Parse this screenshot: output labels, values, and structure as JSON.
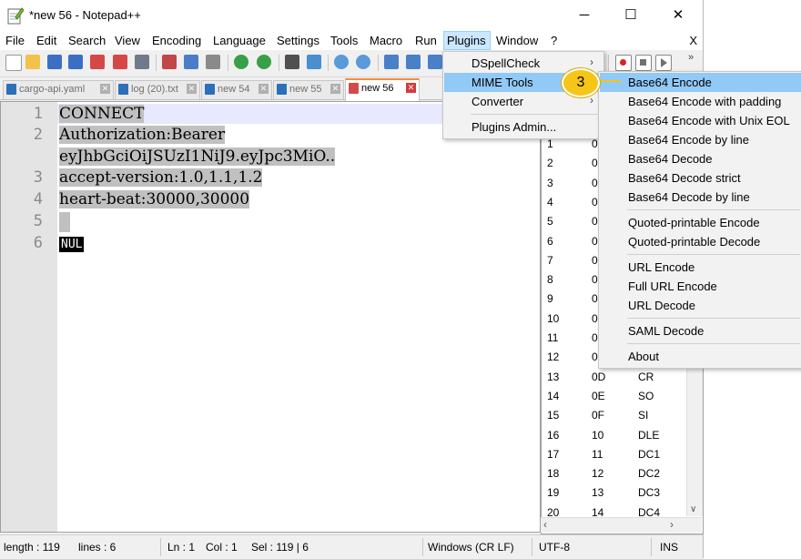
{
  "window": {
    "title": "*new 56 - Notepad++",
    "minimize": "─",
    "maximize": "☐",
    "close": "✕"
  },
  "menu": {
    "items": [
      "File",
      "Edit",
      "Search",
      "View",
      "Encoding",
      "Language",
      "Settings",
      "Tools",
      "Macro",
      "Run",
      "Plugins",
      "Window",
      "?"
    ],
    "close": "X"
  },
  "tabs": [
    "cargo-api.yaml",
    "log (20).txt",
    "new 54",
    "new 55",
    "new 56"
  ],
  "editor": {
    "line_numbers": [
      "1",
      "2",
      "3",
      "4",
      "5",
      "6"
    ],
    "lines": [
      "CONNECT",
      "Authorization:Bearer",
      "eyJhbGciOiJSUzI1NiJ9.eyJpc3MiO..",
      "accept-version:1.0,1.1,1.2",
      "heart-beat:30000,30000",
      "",
      "NUL"
    ]
  },
  "ascii_panel": {
    "rows": [
      {
        "dec": "1",
        "hex": "0",
        "name": ""
      },
      {
        "dec": "2",
        "hex": "0",
        "name": ""
      },
      {
        "dec": "3",
        "hex": "0",
        "name": ""
      },
      {
        "dec": "4",
        "hex": "0",
        "name": ""
      },
      {
        "dec": "5",
        "hex": "0",
        "name": ""
      },
      {
        "dec": "6",
        "hex": "0",
        "name": ""
      },
      {
        "dec": "7",
        "hex": "0",
        "name": ""
      },
      {
        "dec": "8",
        "hex": "0",
        "name": ""
      },
      {
        "dec": "9",
        "hex": "0",
        "name": ""
      },
      {
        "dec": "10",
        "hex": "0",
        "name": ""
      },
      {
        "dec": "11",
        "hex": "0",
        "name": ""
      },
      {
        "dec": "12",
        "hex": "0",
        "name": ""
      },
      {
        "dec": "13",
        "hex": "0D",
        "name": "CR"
      },
      {
        "dec": "14",
        "hex": "0E",
        "name": "SO"
      },
      {
        "dec": "15",
        "hex": "0F",
        "name": "SI"
      },
      {
        "dec": "16",
        "hex": "10",
        "name": "DLE"
      },
      {
        "dec": "17",
        "hex": "11",
        "name": "DC1"
      },
      {
        "dec": "18",
        "hex": "12",
        "name": "DC2"
      },
      {
        "dec": "19",
        "hex": "13",
        "name": "DC3"
      },
      {
        "dec": "20",
        "hex": "14",
        "name": "DC4"
      }
    ]
  },
  "plugins_menu": {
    "items": [
      "DSpellCheck",
      "MIME Tools",
      "Converter",
      "Plugins Admin..."
    ]
  },
  "mime_submenu": {
    "items": [
      "Base64 Encode",
      "Base64 Encode with padding",
      "Base64 Encode with Unix EOL",
      "Base64 Encode by line",
      "Base64 Decode",
      "Base64 Decode strict",
      "Base64 Decode by line",
      "Quoted-printable Encode",
      "Quoted-printable Decode",
      "URL Encode",
      "Full URL Encode",
      "URL Decode",
      "SAML Decode",
      "About"
    ]
  },
  "step_badge": "3",
  "status": {
    "length": "length : 119",
    "lines": "lines : 6",
    "ln": "Ln : 1",
    "col": "Col : 1",
    "sel": "Sel : 119 | 6",
    "eol": "Windows (CR LF)",
    "encoding": "UTF-8",
    "mode": "INS"
  },
  "colors": {
    "accent": "#fa8c3c",
    "menu_highlight": "#91c9f7",
    "badge": "#f5c518"
  }
}
